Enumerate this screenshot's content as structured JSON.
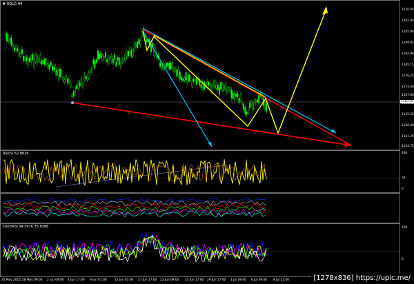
{
  "main_chart": {
    "title": "GOLD,H4",
    "current_price": "1163.49",
    "price_ticks": [
      "1210.45",
      "1202.80",
      "1205.00",
      "1199.95",
      "1192.90",
      "1185.15",
      "1176.25",
      "1173.40",
      "1167.00",
      "1163.55",
      "1155.25",
      "1150.40",
      "1141.25",
      "1134.75"
    ]
  },
  "rsi": {
    "title": "RSI(5) 62.8829",
    "levels": [
      "100",
      "32",
      "0"
    ]
  },
  "stoch": {
    "title": "stochRSI 34.5976 35.8388",
    "levels": [
      "100",
      "0"
    ]
  },
  "time_labels": [
    "25 May 2015",
    "28 May 09:00",
    "2 Jun 09:00",
    "4 Jun 17:00",
    "9 Jun 01:00",
    "12 Jun 01:00",
    "17 Jun 17:00",
    "22 Jun 09:00",
    "25 Jun 17:00",
    "29 Jun 17:00",
    "1 Jul 09:00",
    "6 Jul 09:00",
    "8 Jul 21:00"
  ],
  "watermark": "[1278x836] https://upic.me/",
  "colors": {
    "bull": "#00ff00",
    "bear": "#00aa00",
    "rsi": "#ffff00",
    "red": "#ff0000",
    "cyan": "#00ccff",
    "yellow": "#ffff00"
  }
}
